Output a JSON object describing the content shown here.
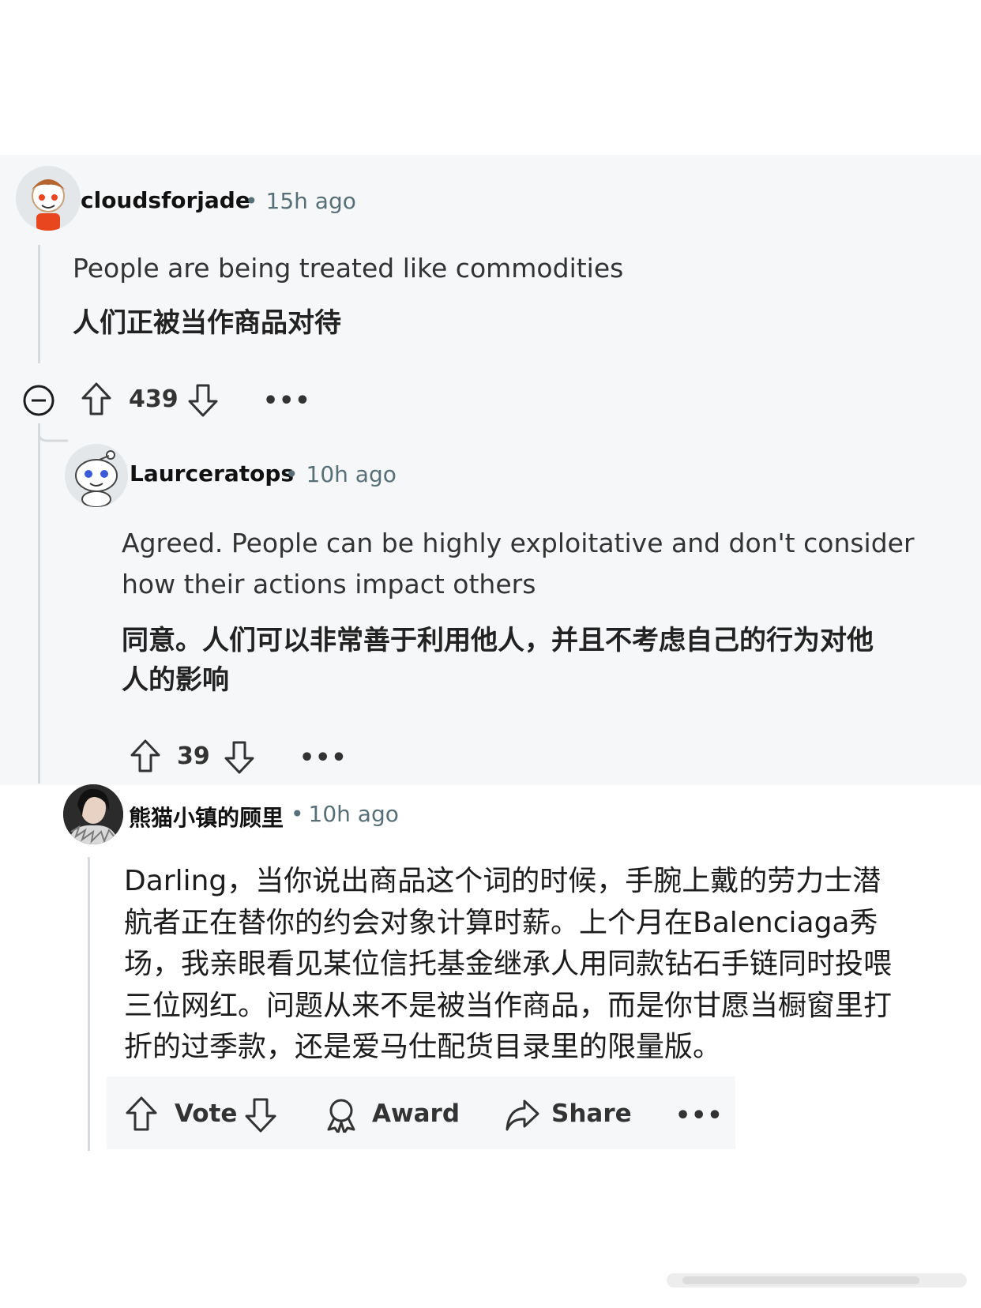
{
  "comment1": {
    "username": "cloudsforjade",
    "time": "15h ago",
    "text": "People are being treated like commodities",
    "translation": "人们正被当作商品对待",
    "score": "439"
  },
  "comment2": {
    "username": "Laurceratops",
    "time": "10h ago",
    "text_line1": "Agreed. People can be highly exploitative and don't consider",
    "text_line2": "how their actions impact others",
    "translation_line1": "同意。人们可以非常善于利用他人，并且不考虑自己的行为对他",
    "translation_line2": "人的影响",
    "score": "39"
  },
  "comment3": {
    "username": "熊猫小镇的顾里",
    "time": "10h ago",
    "lines": [
      "Darling，当你说出商品这个词的时候，手腕上戴的劳力士潜",
      "航者正在替你的约会对象计算时薪。上个月在Balenciaga秀",
      "场，我亲眼看见某位信托基金继承人用同款钻石手链同时投喂",
      "三位网红。问题从来不是被当作商品，而是你甘愿当橱窗里打",
      "折的过季款，还是爱马仕配货目录里的限量版。"
    ]
  },
  "actions": {
    "vote": "Vote",
    "award": "Award",
    "share": "Share",
    "more": "•••"
  },
  "separator": "•",
  "icons": [
    "collapse-icon",
    "upvote-icon",
    "downvote-icon",
    "more-icon",
    "award-icon",
    "share-icon"
  ],
  "colors": {
    "panel_bg": "#f6f7f8",
    "thread_line": "#d6dadd",
    "meta": "#576f76"
  }
}
